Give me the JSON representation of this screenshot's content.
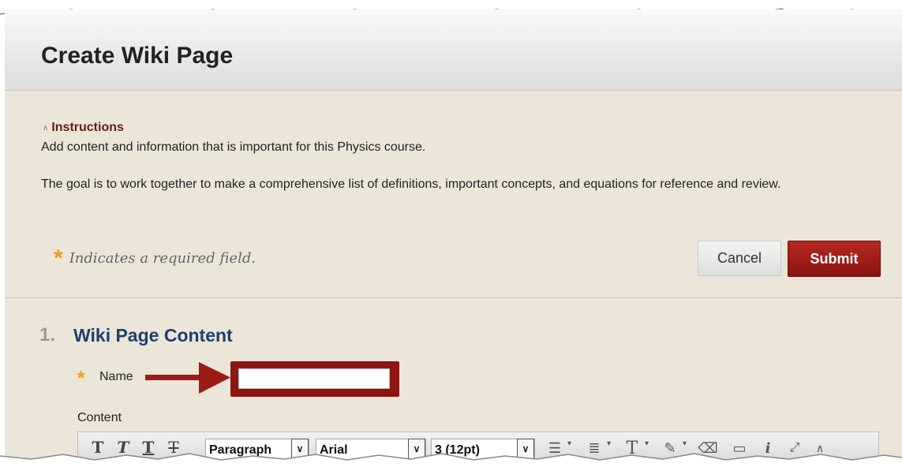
{
  "page": {
    "title": "Create Wiki Page"
  },
  "instructions": {
    "toggle_label": "Instructions",
    "line1": "Add content and information that is important for this Physics course.",
    "line2": "The goal is to work together to make a comprehensive list of definitions, important concepts, and equations for reference and review."
  },
  "required_note": {
    "star": "*",
    "text": "Indicates a required field."
  },
  "buttons": {
    "cancel": "Cancel",
    "submit": "Submit"
  },
  "section": {
    "number": "1.",
    "title": "Wiki Page Content"
  },
  "form": {
    "name_label": "Name",
    "name_value": "",
    "content_label": "Content"
  },
  "toolbar": {
    "bold": "T",
    "italic": "T",
    "underline": "T",
    "strike": "T",
    "paragraph_select": "Paragraph",
    "font_select": "Arial",
    "size_select": "3 (12pt)"
  },
  "colors": {
    "submit": "#9b1c17",
    "instructions_link": "#6b1a14",
    "section_title": "#1e3f6e",
    "required_star": "#f39a18",
    "body_background": "#ebe6d8"
  }
}
